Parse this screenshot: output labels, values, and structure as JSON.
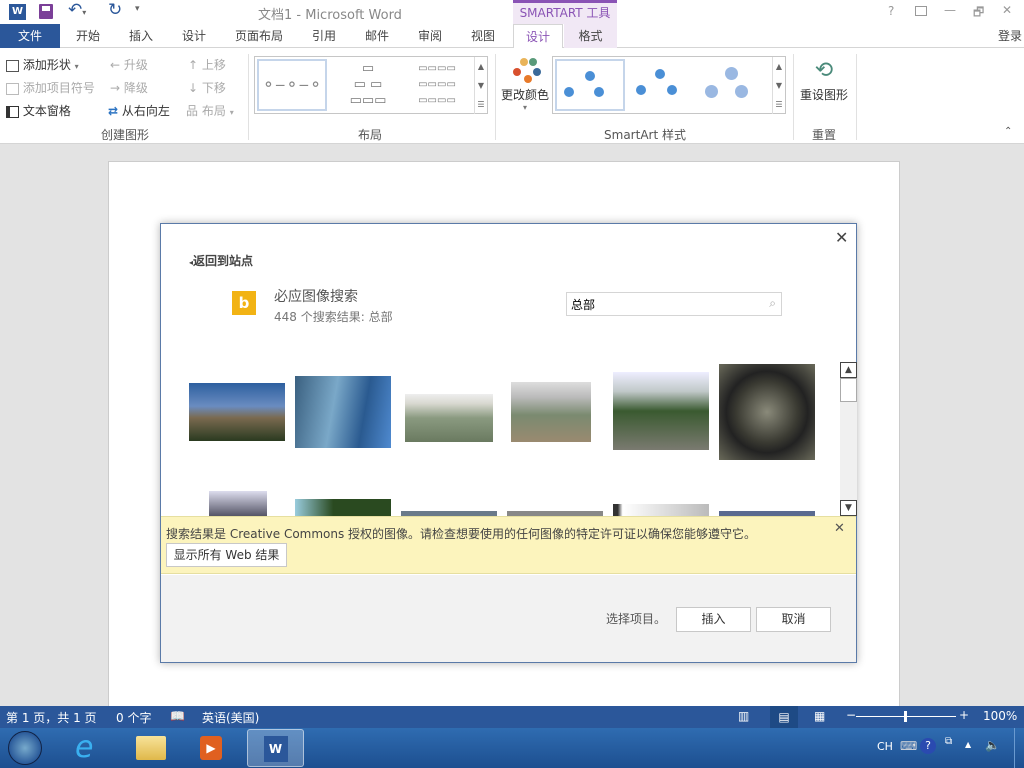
{
  "titlebar": {
    "title": "文档1 - Microsoft Word",
    "context_tools": "SMARTART 工具",
    "help": "?",
    "minimize": "—",
    "restore": "🗗",
    "close": "✕",
    "sign_in": "登录"
  },
  "tabs": [
    {
      "label": "文件"
    },
    {
      "label": "开始"
    },
    {
      "label": "插入"
    },
    {
      "label": "设计"
    },
    {
      "label": "页面布局"
    },
    {
      "label": "引用"
    },
    {
      "label": "邮件"
    },
    {
      "label": "审阅"
    },
    {
      "label": "视图"
    },
    {
      "label": "设计"
    },
    {
      "label": "格式"
    }
  ],
  "ribbon": {
    "create": {
      "add_shape": "添加形状",
      "add_bullet": "添加项目符号",
      "text_pane": "文本窗格",
      "promote": "升级",
      "demote": "降级",
      "rtl": "从右向左",
      "move_up": "上移",
      "move_down": "下移",
      "layout": "布局",
      "group": "创建图形"
    },
    "layouts": {
      "group": "布局"
    },
    "styles": {
      "change_colors": "更改颜色",
      "group": "SmartArt 样式"
    },
    "reset": {
      "reset_graphic": "重设图形",
      "group": "重置"
    }
  },
  "dialog": {
    "back": "返回到站点",
    "source_title": "必应图像搜索",
    "result_count": "448 个搜索结果: 总部",
    "search_value": "总部",
    "notice": "搜索结果是 Creative Commons 授权的图像。请检查想要使用的任何图像的特定许可证以确保您能够遵守它。",
    "show_all": "显示所有 Web 结果",
    "select_hint": "选择项目。",
    "insert": "插入",
    "cancel": "取消"
  },
  "status": {
    "page": "第 1 页，共 1 页",
    "words": "0 个字",
    "language": "英语(美国)",
    "zoom": "100%",
    "zoom_level": 100
  },
  "taskbar": {
    "lang": "CH"
  }
}
